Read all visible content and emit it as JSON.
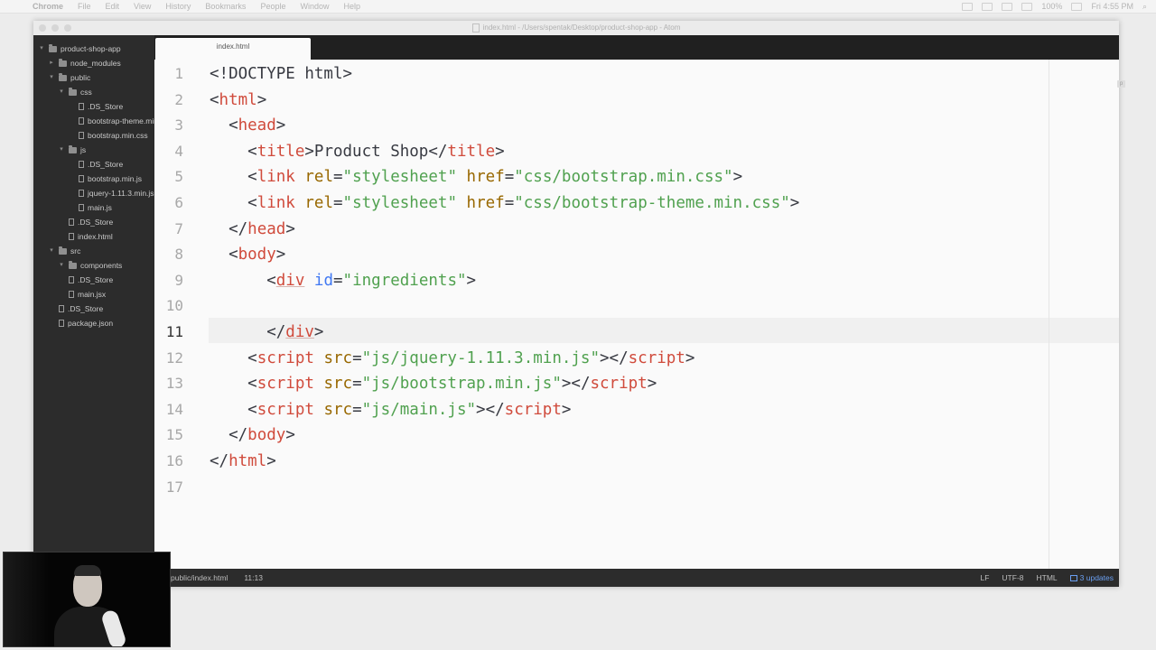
{
  "menubar": {
    "items": [
      "Chrome",
      "File",
      "Edit",
      "View",
      "History",
      "Bookmarks",
      "People",
      "Window",
      "Help"
    ],
    "battery": "100%",
    "clock": "Fri 4:55 PM"
  },
  "window": {
    "title": "index.html - /Users/spentak/Desktop/product-shop-app - Atom"
  },
  "treeview": {
    "items": [
      {
        "label": "product-shop-app",
        "type": "folder",
        "depth": 0,
        "expanded": true
      },
      {
        "label": "node_modules",
        "type": "folder",
        "depth": 1,
        "expanded": false
      },
      {
        "label": "public",
        "type": "folder",
        "depth": 1,
        "expanded": true
      },
      {
        "label": "css",
        "type": "folder",
        "depth": 2,
        "expanded": true
      },
      {
        "label": ".DS_Store",
        "type": "file",
        "depth": 3
      },
      {
        "label": "bootstrap-theme.min.css",
        "type": "file",
        "depth": 3
      },
      {
        "label": "bootstrap.min.css",
        "type": "file",
        "depth": 3
      },
      {
        "label": "js",
        "type": "folder",
        "depth": 2,
        "expanded": true
      },
      {
        "label": ".DS_Store",
        "type": "file",
        "depth": 3
      },
      {
        "label": "bootstrap.min.js",
        "type": "file",
        "depth": 3
      },
      {
        "label": "jquery-1.11.3.min.js",
        "type": "file",
        "depth": 3
      },
      {
        "label": "main.js",
        "type": "file",
        "depth": 3
      },
      {
        "label": ".DS_Store",
        "type": "file",
        "depth": 2
      },
      {
        "label": "index.html",
        "type": "file",
        "depth": 2
      },
      {
        "label": "src",
        "type": "folder",
        "depth": 1,
        "expanded": true
      },
      {
        "label": "components",
        "type": "folder",
        "depth": 2,
        "expanded": true
      },
      {
        "label": ".DS_Store",
        "type": "file",
        "depth": 2
      },
      {
        "label": "main.jsx",
        "type": "file",
        "depth": 2
      },
      {
        "label": ".DS_Store",
        "type": "file",
        "depth": 1
      },
      {
        "label": "package.json",
        "type": "file",
        "depth": 1
      }
    ]
  },
  "tabs": [
    {
      "label": "index.html",
      "active": true
    }
  ],
  "editor": {
    "current_line": 11,
    "lines": [
      [
        [
          "pun",
          "<!DOCTYPE html>"
        ]
      ],
      [
        [
          "pun",
          "<"
        ],
        [
          "tag",
          "html"
        ],
        [
          "pun",
          ">"
        ]
      ],
      [
        [
          "pun",
          "  <"
        ],
        [
          "tag",
          "head"
        ],
        [
          "pun",
          ">"
        ]
      ],
      [
        [
          "pun",
          "    <"
        ],
        [
          "tag",
          "title"
        ],
        [
          "pun",
          ">Product Shop</"
        ],
        [
          "tag",
          "title"
        ],
        [
          "pun",
          ">"
        ]
      ],
      [
        [
          "pun",
          "    <"
        ],
        [
          "tag",
          "link"
        ],
        [
          "pun",
          " "
        ],
        [
          "attr",
          "rel"
        ],
        [
          "pun",
          "="
        ],
        [
          "str",
          "\"stylesheet\""
        ],
        [
          "pun",
          " "
        ],
        [
          "attr",
          "href"
        ],
        [
          "pun",
          "="
        ],
        [
          "str",
          "\"css/bootstrap.min.css\""
        ],
        [
          "pun",
          ">"
        ]
      ],
      [
        [
          "pun",
          "    <"
        ],
        [
          "tag",
          "link"
        ],
        [
          "pun",
          " "
        ],
        [
          "attr",
          "rel"
        ],
        [
          "pun",
          "="
        ],
        [
          "str",
          "\"stylesheet\""
        ],
        [
          "pun",
          " "
        ],
        [
          "attr",
          "href"
        ],
        [
          "pun",
          "="
        ],
        [
          "str",
          "\"css/bootstrap-theme.min.css\""
        ],
        [
          "pun",
          ">"
        ]
      ],
      [
        [
          "pun",
          "  </"
        ],
        [
          "tag",
          "head"
        ],
        [
          "pun",
          ">"
        ]
      ],
      [
        [
          "pun",
          "  <"
        ],
        [
          "tag",
          "body"
        ],
        [
          "pun",
          ">"
        ]
      ],
      [
        [
          "pun",
          "      <"
        ],
        [
          "tagul",
          "div"
        ],
        [
          "pun",
          " "
        ],
        [
          "attrblue",
          "id"
        ],
        [
          "pun",
          "="
        ],
        [
          "str",
          "\"ingredients\""
        ],
        [
          "pun",
          ">"
        ]
      ],
      [],
      [
        [
          "pun",
          "      </"
        ],
        [
          "tagul",
          "div"
        ],
        [
          "pun",
          ">"
        ]
      ],
      [
        [
          "pun",
          "    <"
        ],
        [
          "tag",
          "script"
        ],
        [
          "pun",
          " "
        ],
        [
          "attr",
          "src"
        ],
        [
          "pun",
          "="
        ],
        [
          "str",
          "\"js/jquery-1.11.3.min.js\""
        ],
        [
          "pun",
          "></"
        ],
        [
          "tag",
          "script"
        ],
        [
          "pun",
          ">"
        ]
      ],
      [
        [
          "pun",
          "    <"
        ],
        [
          "tag",
          "script"
        ],
        [
          "pun",
          " "
        ],
        [
          "attr",
          "src"
        ],
        [
          "pun",
          "="
        ],
        [
          "str",
          "\"js/bootstrap.min.js\""
        ],
        [
          "pun",
          "></"
        ],
        [
          "tag",
          "script"
        ],
        [
          "pun",
          ">"
        ]
      ],
      [
        [
          "pun",
          "    <"
        ],
        [
          "tag",
          "script"
        ],
        [
          "pun",
          " "
        ],
        [
          "attr",
          "src"
        ],
        [
          "pun",
          "="
        ],
        [
          "str",
          "\"js/main.js\""
        ],
        [
          "pun",
          "></"
        ],
        [
          "tag",
          "script"
        ],
        [
          "pun",
          ">"
        ]
      ],
      [
        [
          "pun",
          "  </"
        ],
        [
          "tag",
          "body"
        ],
        [
          "pun",
          ">"
        ]
      ],
      [
        [
          "pun",
          "</"
        ],
        [
          "tag",
          "html"
        ],
        [
          "pun",
          ">"
        ]
      ],
      []
    ]
  },
  "statusbar": {
    "file_path": "public/index.html",
    "cursor_position": "11:13",
    "line_ending": "LF",
    "encoding": "UTF-8",
    "grammar": "HTML",
    "updates": "3 updates"
  }
}
